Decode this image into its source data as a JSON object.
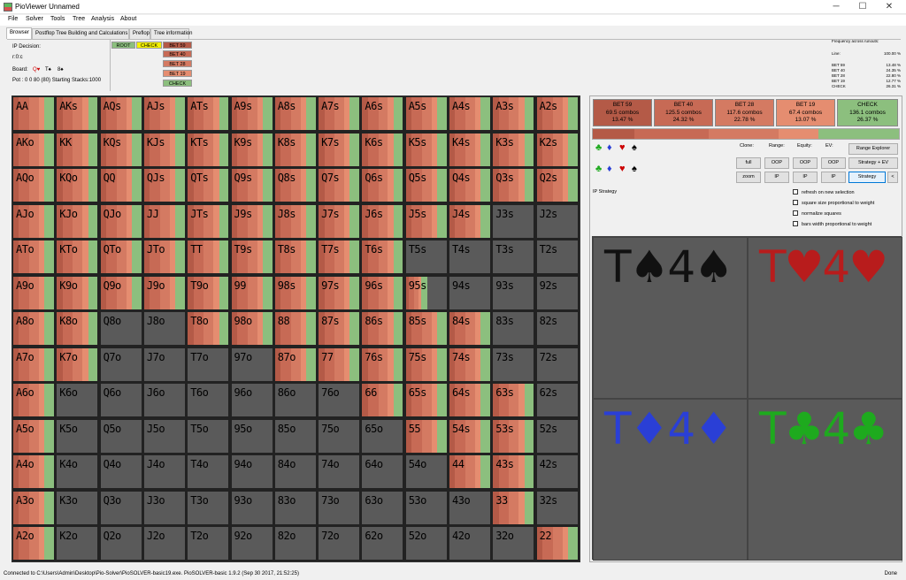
{
  "window": {
    "title": "PioViewer Unnamed",
    "minimize": "─",
    "maximize": "☐",
    "close": "✕"
  },
  "menu": [
    "File",
    "Solver",
    "Tools",
    "Tree",
    "Analysis",
    "About"
  ],
  "tabs": [
    "Browser",
    "Postflop Tree Building and Calculations",
    "Preflop",
    "Tree information"
  ],
  "info": {
    "decision": "IP Decision:",
    "node": "r:0:c",
    "board_label": "Board:",
    "board": [
      "Q♥",
      "T♠",
      "8♠"
    ],
    "pot": "Pot : 0 0 80 (80) Starting Stacks:1000"
  },
  "tree": {
    "root": "ROOT",
    "check": "CHECK",
    "actions": [
      "BET 59",
      "BET 40",
      "BET 28",
      "BET 19",
      "CHECK"
    ]
  },
  "freq": {
    "title": "Frequency across runouts:",
    "line_label": "Line:",
    "line_value": "100.00 %",
    "rows": [
      [
        "BET 59",
        "13.48 %"
      ],
      [
        "BET 40",
        "24.35 %"
      ],
      [
        "BET 28",
        "22.80 %"
      ],
      [
        "BET 19",
        "12.77 %"
      ],
      [
        "CHECK",
        "26.31 %"
      ]
    ]
  },
  "colors": {
    "bet59": "#b45a47",
    "bet40": "#c76a55",
    "bet28": "#d47a62",
    "bet19": "#e58d70",
    "check": "#8cbf7e",
    "empty": "#5a5a5a"
  },
  "grid": {
    "labels": [
      [
        "AA",
        "AKs",
        "AQs",
        "AJs",
        "ATs",
        "A9s",
        "A8s",
        "A7s",
        "A6s",
        "A5s",
        "A4s",
        "A3s",
        "A2s"
      ],
      [
        "AKo",
        "KK",
        "KQs",
        "KJs",
        "KTs",
        "K9s",
        "K8s",
        "K7s",
        "K6s",
        "K5s",
        "K4s",
        "K3s",
        "K2s"
      ],
      [
        "AQo",
        "KQo",
        "QQ",
        "QJs",
        "QTs",
        "Q9s",
        "Q8s",
        "Q7s",
        "Q6s",
        "Q5s",
        "Q4s",
        "Q3s",
        "Q2s"
      ],
      [
        "AJo",
        "KJo",
        "QJo",
        "JJ",
        "JTs",
        "J9s",
        "J8s",
        "J7s",
        "J6s",
        "J5s",
        "J4s",
        "J3s",
        "J2s"
      ],
      [
        "ATo",
        "KTo",
        "QTo",
        "JTo",
        "TT",
        "T9s",
        "T8s",
        "T7s",
        "T6s",
        "T5s",
        "T4s",
        "T3s",
        "T2s"
      ],
      [
        "A9o",
        "K9o",
        "Q9o",
        "J9o",
        "T9o",
        "99",
        "98s",
        "97s",
        "96s",
        "95s",
        "94s",
        "93s",
        "92s"
      ],
      [
        "A8o",
        "K8o",
        "Q8o",
        "J8o",
        "T8o",
        "98o",
        "88",
        "87s",
        "86s",
        "85s",
        "84s",
        "83s",
        "82s"
      ],
      [
        "A7o",
        "K7o",
        "Q7o",
        "J7o",
        "T7o",
        "97o",
        "87o",
        "77",
        "76s",
        "75s",
        "74s",
        "73s",
        "72s"
      ],
      [
        "A6o",
        "K6o",
        "Q6o",
        "J6o",
        "T6o",
        "96o",
        "86o",
        "76o",
        "66",
        "65s",
        "64s",
        "63s",
        "62s"
      ],
      [
        "A5o",
        "K5o",
        "Q5o",
        "J5o",
        "T5o",
        "95o",
        "85o",
        "75o",
        "65o",
        "55",
        "54s",
        "53s",
        "52s"
      ],
      [
        "A4o",
        "K4o",
        "Q4o",
        "J4o",
        "T4o",
        "94o",
        "84o",
        "74o",
        "64o",
        "54o",
        "44",
        "43s",
        "42s"
      ],
      [
        "A3o",
        "K3o",
        "Q3o",
        "J3o",
        "T3o",
        "93o",
        "83o",
        "73o",
        "63o",
        "53o",
        "43o",
        "33",
        "32s"
      ],
      [
        "A2o",
        "K2o",
        "Q2o",
        "J2o",
        "T2o",
        "92o",
        "82o",
        "72o",
        "62o",
        "52o",
        "42o",
        "32o",
        "22"
      ]
    ],
    "weights": [
      [
        1,
        1,
        1,
        1,
        1,
        1,
        1,
        1,
        1,
        1,
        1,
        1,
        1
      ],
      [
        1,
        1,
        1,
        1,
        1,
        1,
        1,
        1,
        1,
        1,
        1,
        1,
        1
      ],
      [
        1,
        1,
        1,
        1,
        1,
        1,
        1,
        1,
        1,
        1,
        1,
        1,
        1
      ],
      [
        1,
        1,
        1,
        1,
        1,
        1,
        1,
        1,
        1,
        1,
        1,
        0,
        0
      ],
      [
        1,
        1,
        1,
        1,
        1,
        1,
        1,
        1,
        1,
        0,
        0,
        0,
        0
      ],
      [
        1,
        1,
        1,
        1,
        1,
        1,
        1,
        1,
        1,
        0.5,
        0,
        0,
        0
      ],
      [
        1,
        1,
        0,
        0,
        1,
        1,
        1,
        1,
        1,
        1,
        1,
        0,
        0
      ],
      [
        1,
        1,
        0,
        0,
        0,
        0,
        1,
        1,
        1,
        1,
        1,
        0,
        0
      ],
      [
        1,
        0,
        0,
        0,
        0,
        0,
        0,
        0,
        1,
        1,
        1,
        1,
        0
      ],
      [
        1,
        0,
        0,
        0,
        0,
        0,
        0,
        0,
        0,
        1,
        1,
        1,
        0
      ],
      [
        1,
        0,
        0,
        0,
        0,
        0,
        0,
        0,
        0,
        0,
        1,
        1,
        0
      ],
      [
        1,
        0,
        0,
        0,
        0,
        0,
        0,
        0,
        0,
        0,
        0,
        1,
        0
      ],
      [
        1,
        0,
        0,
        0,
        0,
        0,
        0,
        0,
        0,
        0,
        0,
        0,
        1
      ]
    ]
  },
  "actions": [
    {
      "name": "BET 59",
      "combos": "69.5 combos",
      "pct": "13.47 %",
      "freq": 13.47
    },
    {
      "name": "BET 40",
      "combos": "125.5 combos",
      "pct": "24.32 %",
      "freq": 24.32
    },
    {
      "name": "BET 28",
      "combos": "117.6 combos",
      "pct": "22.78 %",
      "freq": 22.78
    },
    {
      "name": "BET 19",
      "combos": "67.4 combos",
      "pct": "13.07 %",
      "freq": 13.07
    },
    {
      "name": "CHECK",
      "combos": "136.1 combos",
      "pct": "26.37 %",
      "freq": 26.37
    }
  ],
  "controls": {
    "clone": "Clone:",
    "range": "Range:",
    "equity": "Equity:",
    "ev": "EV:",
    "full": "full",
    "zoom": "zoom",
    "oop": "OOP",
    "ip": "IP",
    "range_explorer": "Range Explorer",
    "strategy_ev": "Strategy + EV",
    "strategy": "Strategy",
    "collapse": "<",
    "ip_strategy": "IP Strategy"
  },
  "checkboxes": [
    "refresh on new selection",
    "square size proportional to weight",
    "normalize squares",
    "bars width proportional to weight"
  ],
  "combos": [
    {
      "rank1": "T",
      "suit1": "♠",
      "rank2": "4",
      "suit2": "♠",
      "color": "#111111"
    },
    {
      "rank1": "T",
      "suit1": "♥",
      "rank2": "4",
      "suit2": "♥",
      "color": "#b81c1c"
    },
    {
      "rank1": "T",
      "suit1": "♦",
      "rank2": "4",
      "suit2": "♦",
      "color": "#2a3fd6"
    },
    {
      "rank1": "T",
      "suit1": "♣",
      "rank2": "4",
      "suit2": "♣",
      "color": "#1eaa1e"
    }
  ],
  "status": {
    "text": "Connected to C:\\Users\\Admin\\Desktop\\Pio-Solver\\PioSOLVER-basic19.exe. PioSOLVER-basic 1.9.2 (Sep 30 2017, 21:52:25)",
    "right": "Done"
  }
}
